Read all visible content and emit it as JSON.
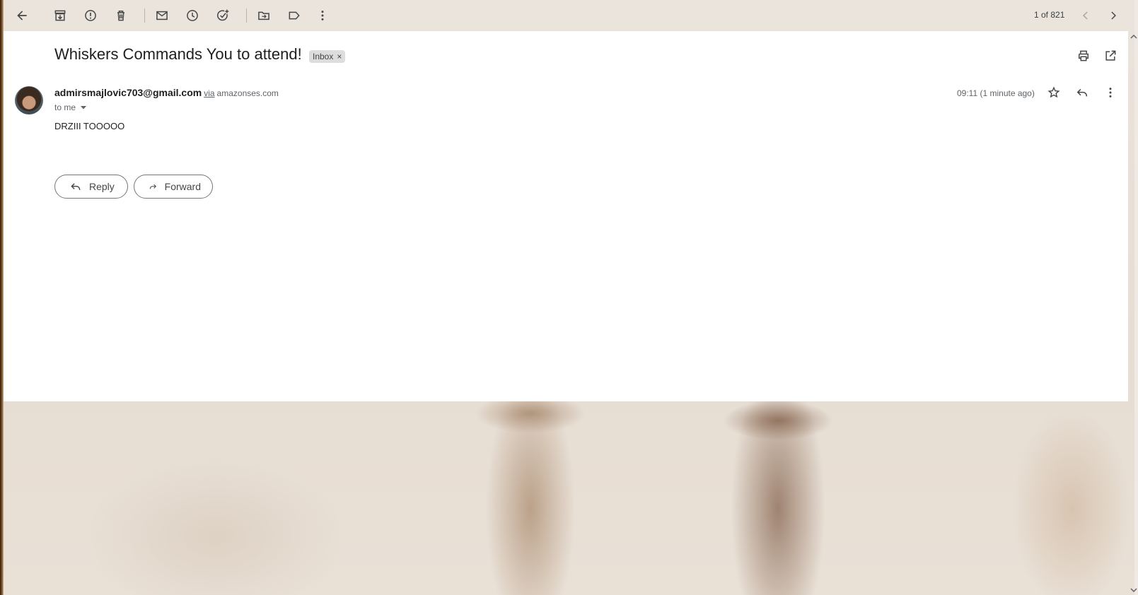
{
  "toolbar": {
    "back_icon": "arrow-left-icon",
    "archive_icon": "archive-icon",
    "report_spam_icon": "report-icon",
    "delete_icon": "trash-icon",
    "mark_unread_icon": "envelope-icon",
    "snooze_icon": "clock-icon",
    "add_task_icon": "add-task-icon",
    "move_to_icon": "folder-move-icon",
    "labels_icon": "label-icon",
    "more_icon": "more-vert-icon",
    "pager_text": "1 of 821",
    "prev_icon": "chevron-left-icon",
    "next_icon": "chevron-right-icon"
  },
  "message": {
    "subject": "Whiskers Commands You to attend!",
    "label": "Inbox",
    "label_remove": "×",
    "sender_email": "admirsmajlovic703@gmail.com",
    "via_text": "via",
    "via_domain": "amazonses.com",
    "recipient_text": "to me",
    "timestamp": "09:11 (1 minute ago)",
    "body": "DRZIII TOOOOO"
  },
  "actions": {
    "reply_label": "Reply",
    "forward_label": "Forward"
  },
  "colors": {
    "card_background": "#ffffff",
    "text_primary": "#1f1f1f",
    "text_secondary": "#5f6368",
    "chip_background": "#dddddd"
  }
}
